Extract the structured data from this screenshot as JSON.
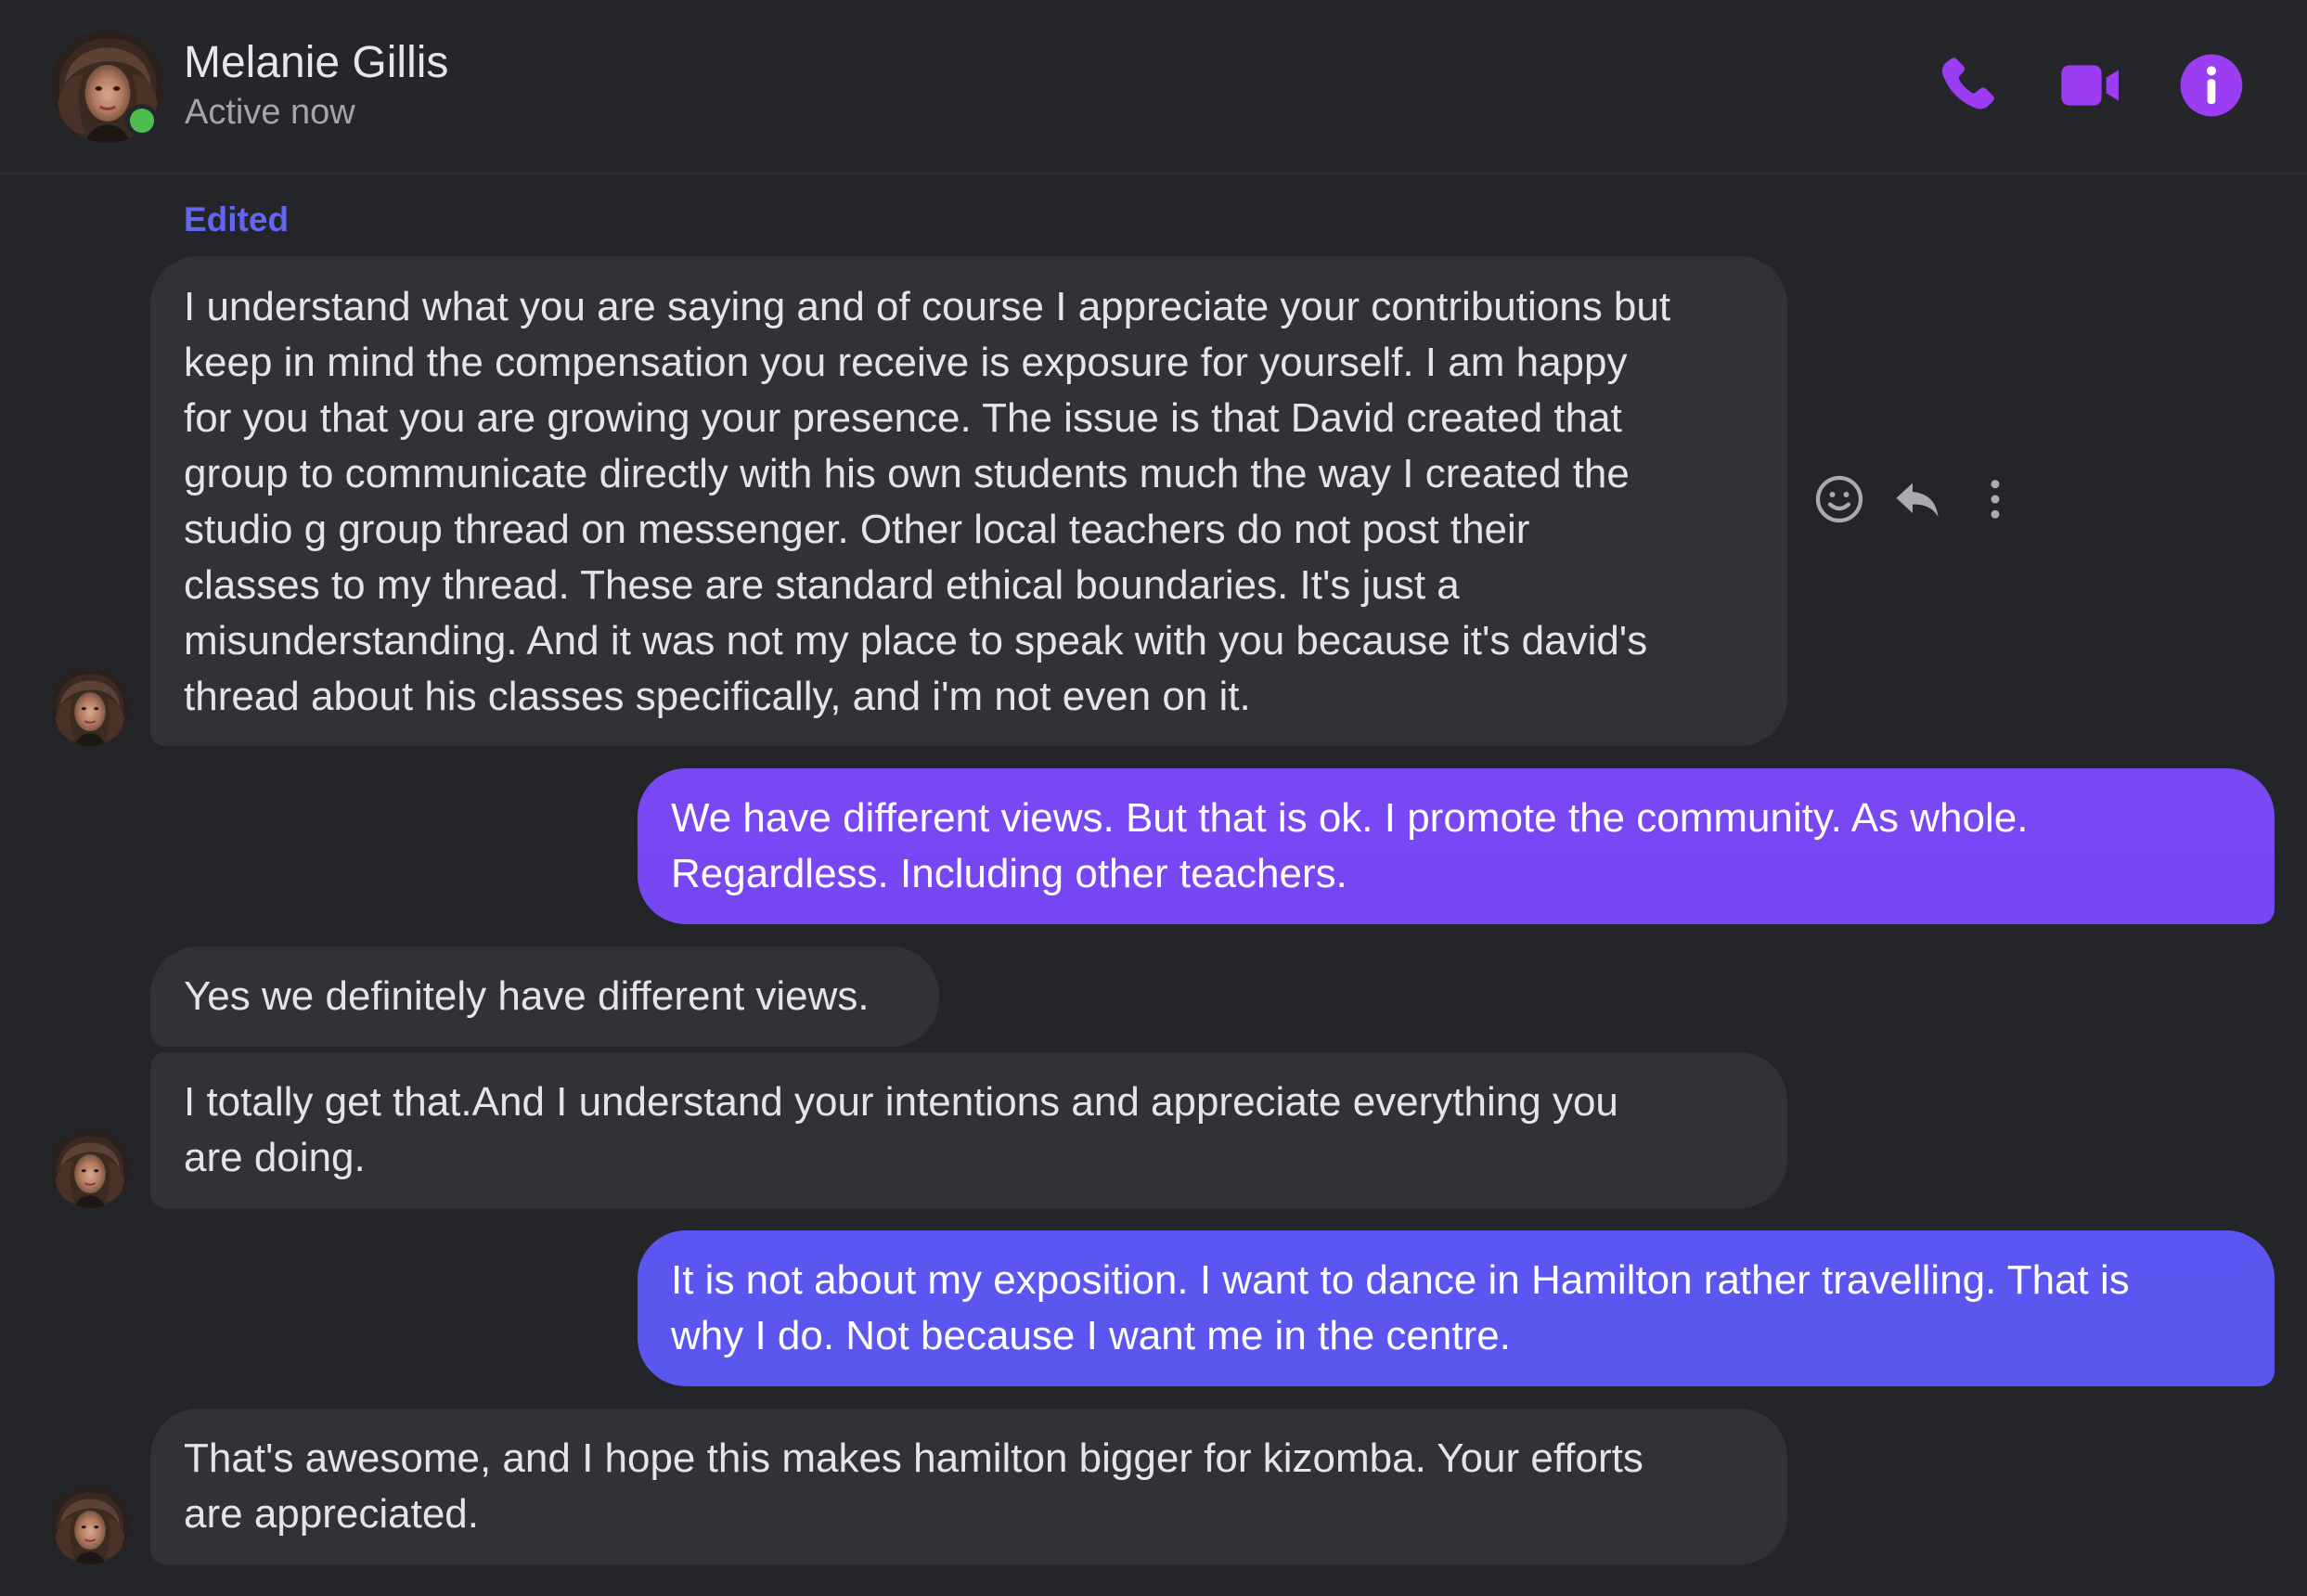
{
  "header": {
    "contact_name": "Melanie Gillis",
    "status": "Active now",
    "icons": [
      "phone-icon",
      "video-camera-icon",
      "info-icon"
    ]
  },
  "colors": {
    "accent": "#9b3ef3",
    "outgoing_violet": "#7a48f4",
    "outgoing_indigo": "#5a57f0",
    "incoming_bubble": "#313236",
    "background": "#242528",
    "edited_label": "#6366f1",
    "online": "#4fbd4e"
  },
  "messages": [
    {
      "edited_label": "Edited",
      "text": "I understand what you are saying and of course I appreciate your contributions but\nkeep in mind the compensation you receive is exposure for yourself.  I am happy\nfor you that you are growing your presence. The issue is that David created that\ngroup to communicate directly with his own students much the way I created the\nstudio g group thread on messenger.  Other local teachers do not post their\nclasses to my thread. These are standard ethical boundaries. It's just a\nmisunderstanding. And it was not my place to speak with you because it's david's\nthread about his classes specifically, and i'm not even on it."
    },
    {
      "text": "We have different views. But that is ok. I promote the community. As whole.\nRegardless. Including other teachers."
    },
    {
      "text": "Yes we definitely have different views."
    },
    {
      "text": "I totally get that.And I understand your intentions and appreciate everything you\nare doing."
    },
    {
      "text": "It is not about my exposition. I want to dance in Hamilton rather travelling. That is\nwhy I do. Not because I want me in the centre."
    },
    {
      "text": "That's awesome, and I hope this makes hamilton bigger for kizomba. Your efforts\nare appreciated."
    }
  ],
  "message_actions": {
    "icons": [
      "emoji-react-icon",
      "reply-icon",
      "more-options-icon"
    ]
  }
}
